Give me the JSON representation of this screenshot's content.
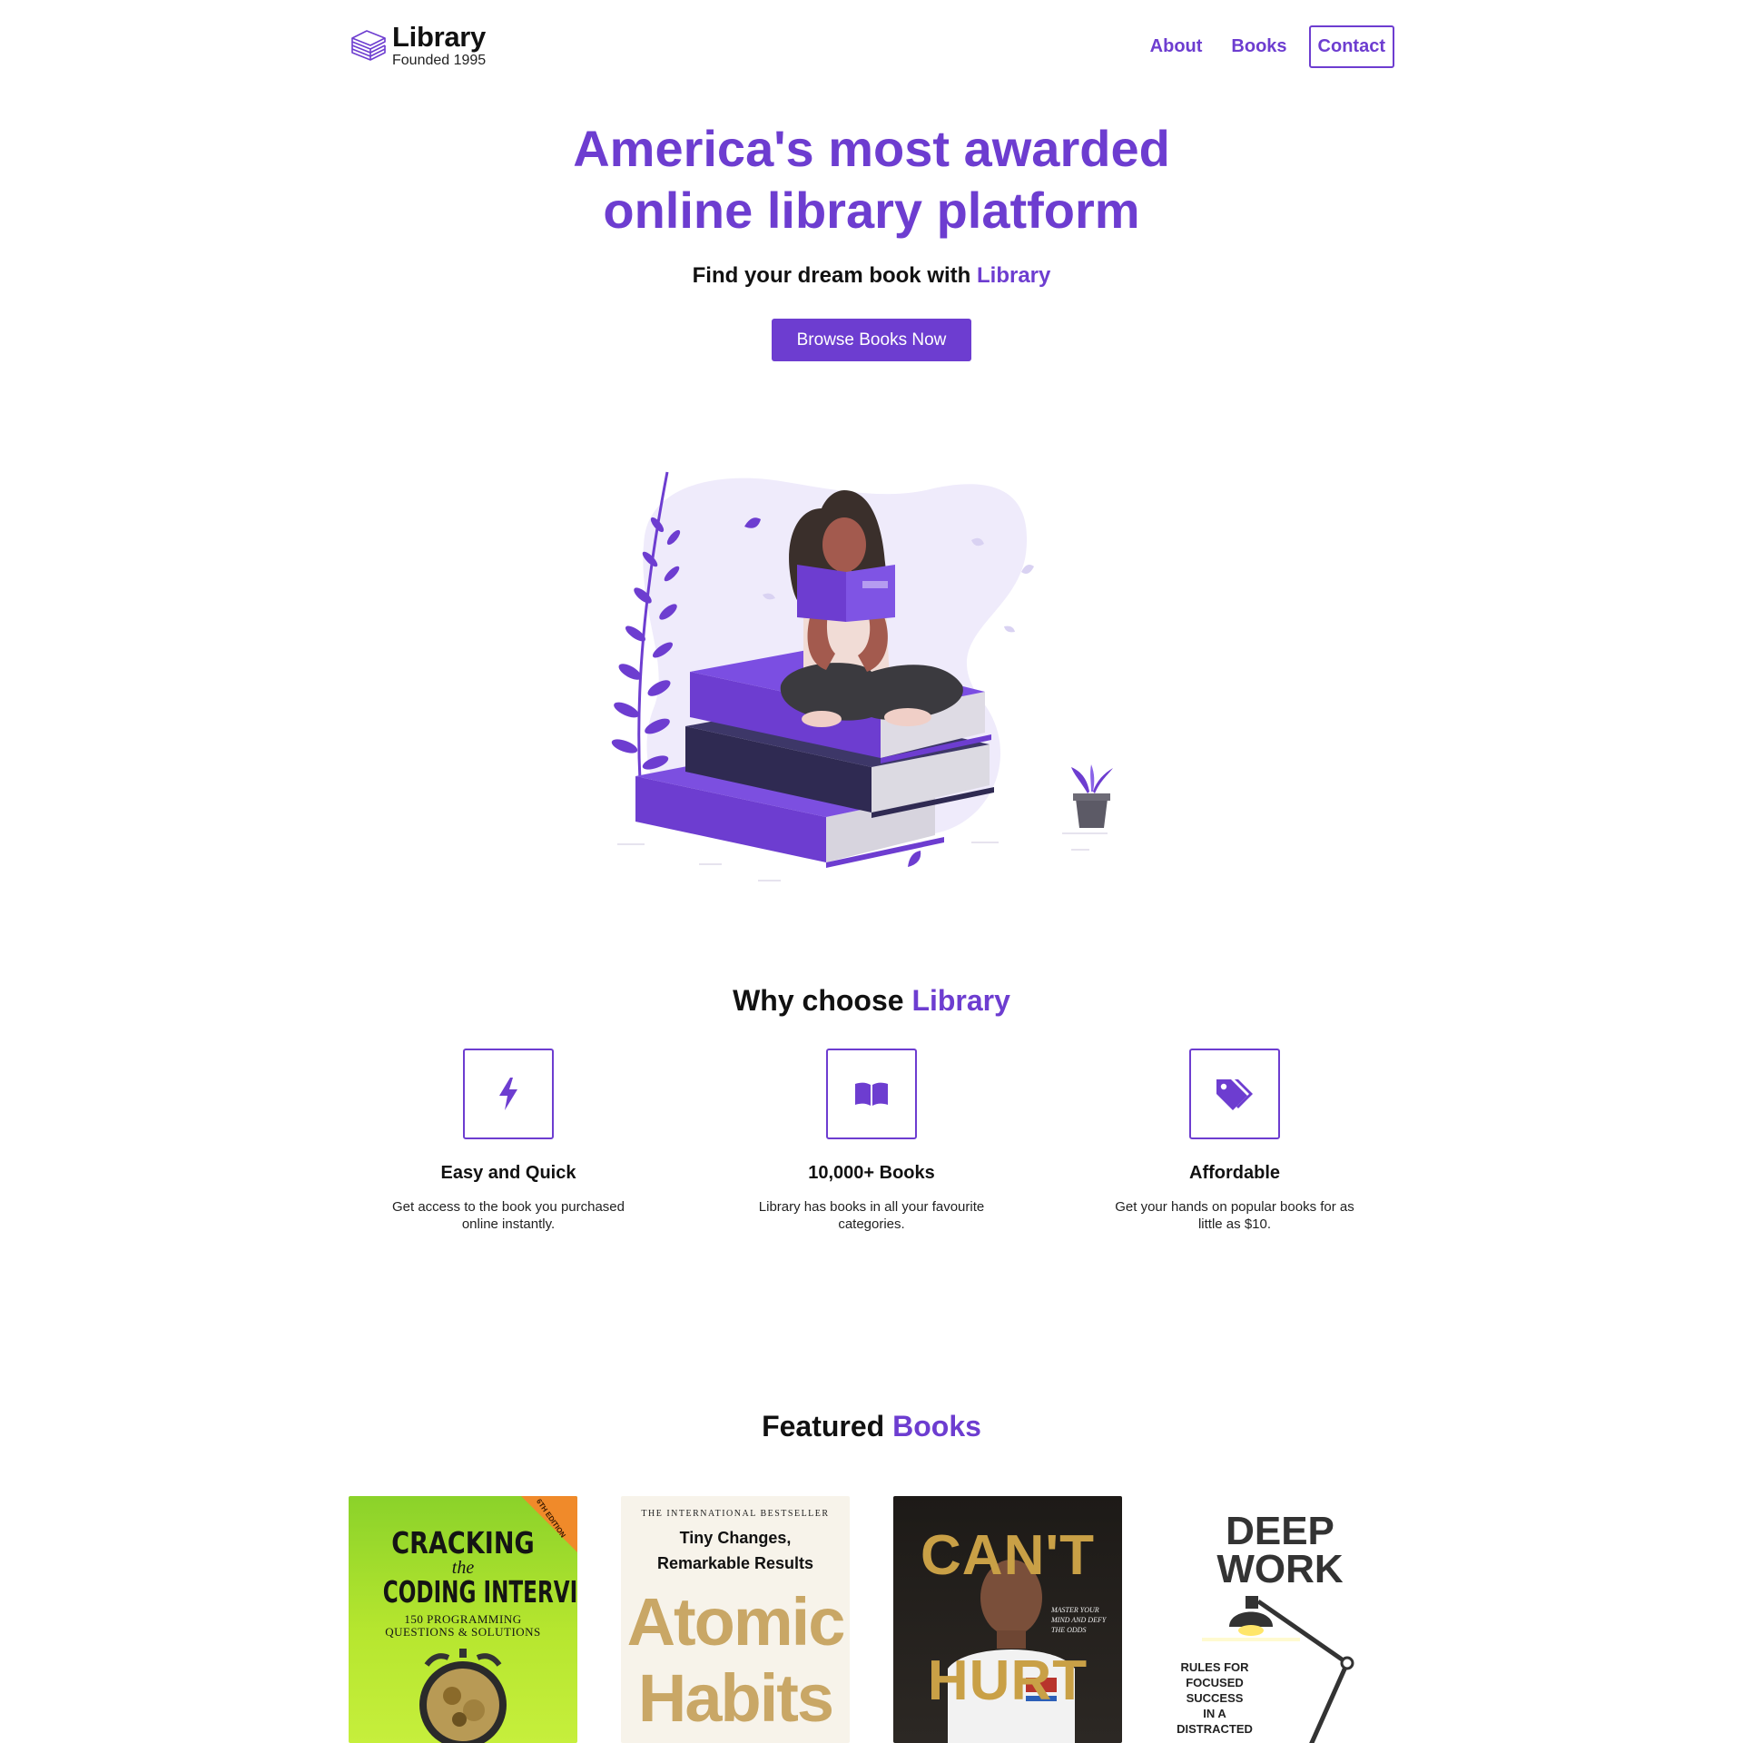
{
  "nav": {
    "logo_title": "Library",
    "logo_subtitle": "Founded 1995",
    "links": [
      "About",
      "Books",
      "Contact"
    ]
  },
  "hero": {
    "title_line1": "America's most awarded",
    "title_line2": "online library platform",
    "subtitle_prefix": "Find your dream book with ",
    "subtitle_accent": "Library",
    "button_label": "Browse Books Now"
  },
  "why": {
    "title_prefix": "Why choose ",
    "title_accent": "Library",
    "features": [
      {
        "icon": "bolt-icon",
        "title": "Easy and Quick",
        "desc_line1": "Get access to the book you purchased",
        "desc_line2": "online instantly."
      },
      {
        "icon": "open-book-icon",
        "title": "10,000+ Books",
        "desc_line1": "Library has books in all your favourite",
        "desc_line2": "categories."
      },
      {
        "icon": "tags-icon",
        "title": "Affordable",
        "desc_line1": "Get your hands on popular books for as",
        "desc_line2": "little as $10."
      }
    ]
  },
  "featured": {
    "title_prefix": "Featured ",
    "title_accent": "Books",
    "books": [
      {
        "cover_lines": [
          "CRACKING",
          "the",
          "CODING INTERVIEW",
          "150 PROGRAMMING",
          "QUESTIONS & SOLUTIONS"
        ],
        "edition": "6TH EDITION"
      },
      {
        "cover_lines": [
          "THE INTERNATIONAL BESTSELLER",
          "Tiny Changes,",
          "Remarkable Results",
          "Atomic",
          "Habits"
        ]
      },
      {
        "cover_lines": [
          "CAN'T",
          "HURT",
          "MASTER YOUR",
          "MIND AND DEFY",
          "THE ODDS"
        ]
      },
      {
        "cover_lines": [
          "DEEP",
          "WORK",
          "RULES FOR",
          "FOCUSED",
          "SUCCESS",
          "IN A",
          "DISTRACTED"
        ]
      }
    ]
  },
  "colors": {
    "accent": "#6d3dd0",
    "text": "#111111",
    "background": "#ffffff"
  }
}
